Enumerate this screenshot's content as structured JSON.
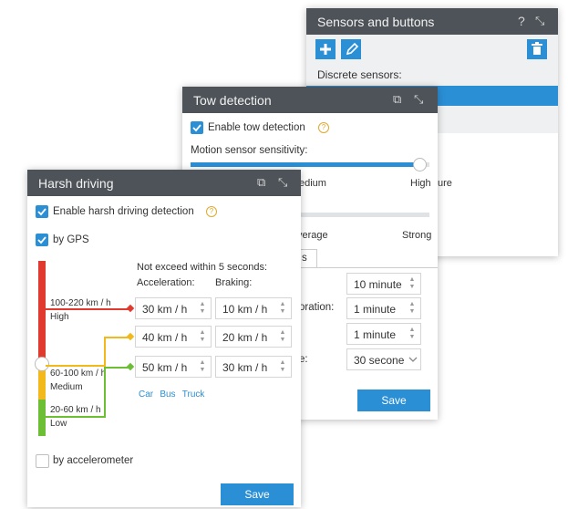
{
  "sensors": {
    "title": "Sensors and buttons",
    "discrete_label": "Discrete sensors:"
  },
  "tow": {
    "title": "Tow detection",
    "enable_label": "Enable tow detection",
    "motion_label": "Motion sensor sensitivity:",
    "slider_labels": [
      "edium",
      "High"
    ],
    "slider2_labels": [
      "verage",
      "Strong"
    ],
    "cut_text": "ure",
    "tab_fragment": "s",
    "rows": [
      {
        "label": "",
        "value": "10 minute"
      },
      {
        "label": "oration:",
        "value": "1 minute"
      },
      {
        "label": "",
        "value": "1 minute"
      },
      {
        "label": "e:",
        "value": "30 secone"
      }
    ],
    "save_label": "Save"
  },
  "harsh": {
    "title": "Harsh driving",
    "enable_label": "Enable harsh driving detection",
    "gps_label": "by GPS",
    "header": "Not exceed within 5 seconds:",
    "accel_label": "Acceleration:",
    "braking_label": "Braking:",
    "levels": [
      {
        "speed": "100-220 km / h",
        "name": "High",
        "accel": "30 km / h",
        "braking": "10 km / h"
      },
      {
        "speed": "60-100 km / h",
        "name": "Medium",
        "accel": "40 km / h",
        "braking": "20 km / h"
      },
      {
        "speed": "20-60 km / h",
        "name": "Low",
        "accel": "50 km / h",
        "braking": "30 km / h"
      }
    ],
    "vehicle_links": [
      "Car",
      "Bus",
      "Truck"
    ],
    "accelerometer_label": "by accelerometer",
    "save_label": "Save"
  },
  "colors": {
    "accent": "#2b8fd6",
    "high": "#e03a2f",
    "medium": "#f2b81c",
    "low": "#6cbf35",
    "titlebar": "#4d5358"
  },
  "icons": {
    "help": "?",
    "collapse": "⤡",
    "copy": "⧉"
  }
}
